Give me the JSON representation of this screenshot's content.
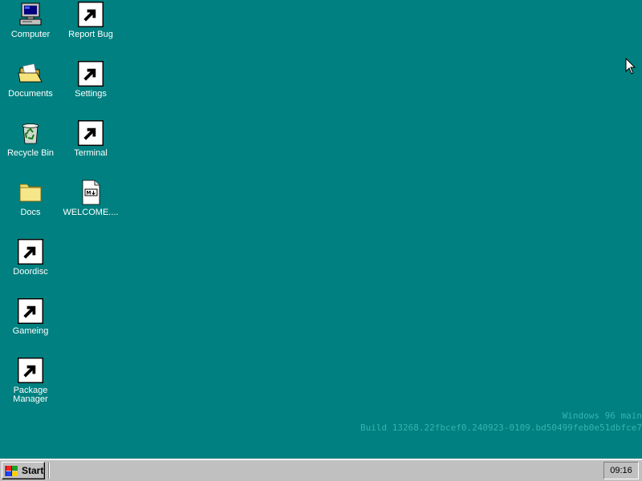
{
  "desktop": {
    "background": "#008080",
    "icons": [
      {
        "label": "Computer",
        "icon": "computer-icon",
        "shortcut": false
      },
      {
        "label": "Report Bug",
        "icon": "report-bug-icon",
        "shortcut": true
      },
      {
        "label": "Documents",
        "icon": "open-folder-icon",
        "shortcut": false
      },
      {
        "label": "Settings",
        "icon": "settings-folder-icon",
        "shortcut": true
      },
      {
        "label": "Recycle Bin",
        "icon": "recycle-bin-icon",
        "shortcut": false
      },
      {
        "label": "Terminal",
        "icon": "terminal-icon",
        "shortcut": true
      },
      {
        "label": "Docs",
        "icon": "folder-icon",
        "shortcut": false
      },
      {
        "label": "WELCOME....",
        "icon": "markdown-file-icon",
        "shortcut": false
      },
      {
        "label": "Doordisc",
        "icon": "doordisc-icon",
        "shortcut": true
      },
      {
        "label": "Gameing",
        "icon": "game-cube-icon",
        "shortcut": true
      },
      {
        "label": "Package\nManager",
        "icon": "package-manager-icon",
        "shortcut": true
      }
    ]
  },
  "watermark": {
    "line1": "Windows 96 main",
    "line2": "Build 13268.22fbcef0.240923-0109.bd50499feb0e51dbfce7"
  },
  "taskbar": {
    "start_label": "Start",
    "clock": "09:16"
  }
}
